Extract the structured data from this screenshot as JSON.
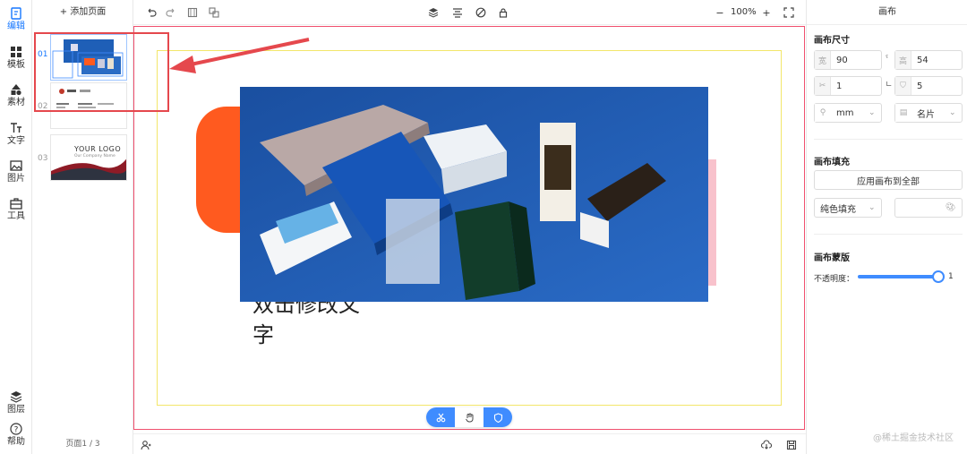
{
  "rail": {
    "items": [
      {
        "label": "编辑",
        "icon": "edit-icon",
        "active": true
      },
      {
        "label": "模板",
        "icon": "template-icon"
      },
      {
        "label": "素材",
        "icon": "material-icon"
      },
      {
        "label": "文字",
        "icon": "text-icon"
      },
      {
        "label": "图片",
        "icon": "image-icon"
      },
      {
        "label": "工具",
        "icon": "toolbox-icon"
      },
      {
        "label": "图层",
        "icon": "layers-icon"
      },
      {
        "label": "帮助",
        "icon": "help-icon"
      }
    ]
  },
  "pages": {
    "add_label": "+ 添加页面",
    "numbers": [
      "01",
      "02",
      "03"
    ],
    "thumb2_text": [
      "中信",
      "感谢"
    ],
    "thumb3_logo": "YOUR LOGO",
    "thumb3_sub": "Our Company Name",
    "footer": "页面1 / 3"
  },
  "toolbar": {
    "zoom": "100%",
    "zoom_minus": "−",
    "zoom_plus": "+"
  },
  "canvas": {
    "text_line1": "双击修改文",
    "text_line2": "字"
  },
  "right": {
    "title": "画布",
    "size_title": "画布尺寸",
    "width_label": "宽",
    "width": "90",
    "height_label": "高",
    "height": "54",
    "bleed": "1",
    "radius": "5",
    "unit": "mm",
    "type": "名片",
    "fill_title": "画布填充",
    "apply_all": "应用画布到全部",
    "fill_mode": "纯色填充",
    "mask_title": "画布蒙版",
    "opacity_label": "不透明度：",
    "opacity_value": "1"
  },
  "watermark": "@稀土掘金技术社区",
  "colors": {
    "accent": "#1677ff",
    "frame": "#f0506e",
    "bleed": "#f3e66a",
    "orange": "#ff5a1f",
    "product_bg": "#1f5fb7",
    "annotation": "#e5484d"
  }
}
